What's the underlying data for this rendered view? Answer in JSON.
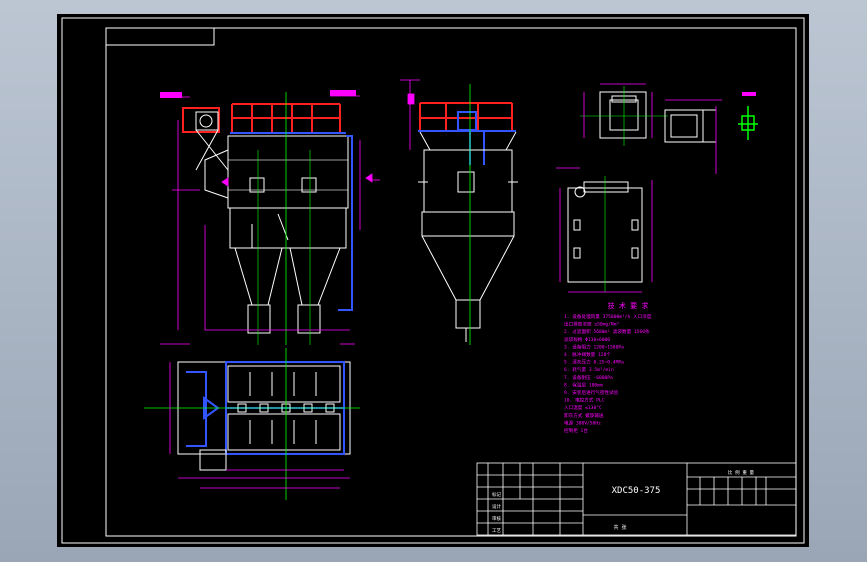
{
  "drawing": {
    "model_code": "XDC50-375",
    "footer_label": "共 张",
    "title_block_header": "比 例  重 量",
    "colors": {
      "paper": "#000000",
      "frame": "#ffffff",
      "magenta": "#ff00ff",
      "blue": "#3355ff",
      "red": "#ff2020",
      "green": "#00ff00",
      "cyan": "#00ffff",
      "yellow": "#ffff00"
    }
  },
  "tech_requirements": {
    "title": "技 术 要 求",
    "lines": [
      "1. 设备处理风量 375000m³/h 入口浓度",
      "   出口排放浓度 ≤50mg/Nm³",
      "2. 过滤面积 5680m² 滤袋数量 1560条",
      "   滤袋规格 Φ130×6000",
      "3. 设备阻力 1200~1500Pa",
      "4. 脉冲阀数量 120个",
      "5. 清灰压力 0.25~0.4MPa",
      "6. 耗气量 3.5m³/min",
      "7. 设备耐压 -6000Pa",
      "8. 保温层 100mm",
      "9. 安装后进行气密性试验",
      "10. 电控方式 PLC",
      "   入口温度 ≤130°C",
      "   卸灰方式 螺旋输送",
      "   电源 380V/50Hz",
      "   控制柜 1台"
    ]
  },
  "title_block": {
    "rows": [
      "标记",
      "设计",
      "审核",
      "工艺"
    ]
  }
}
